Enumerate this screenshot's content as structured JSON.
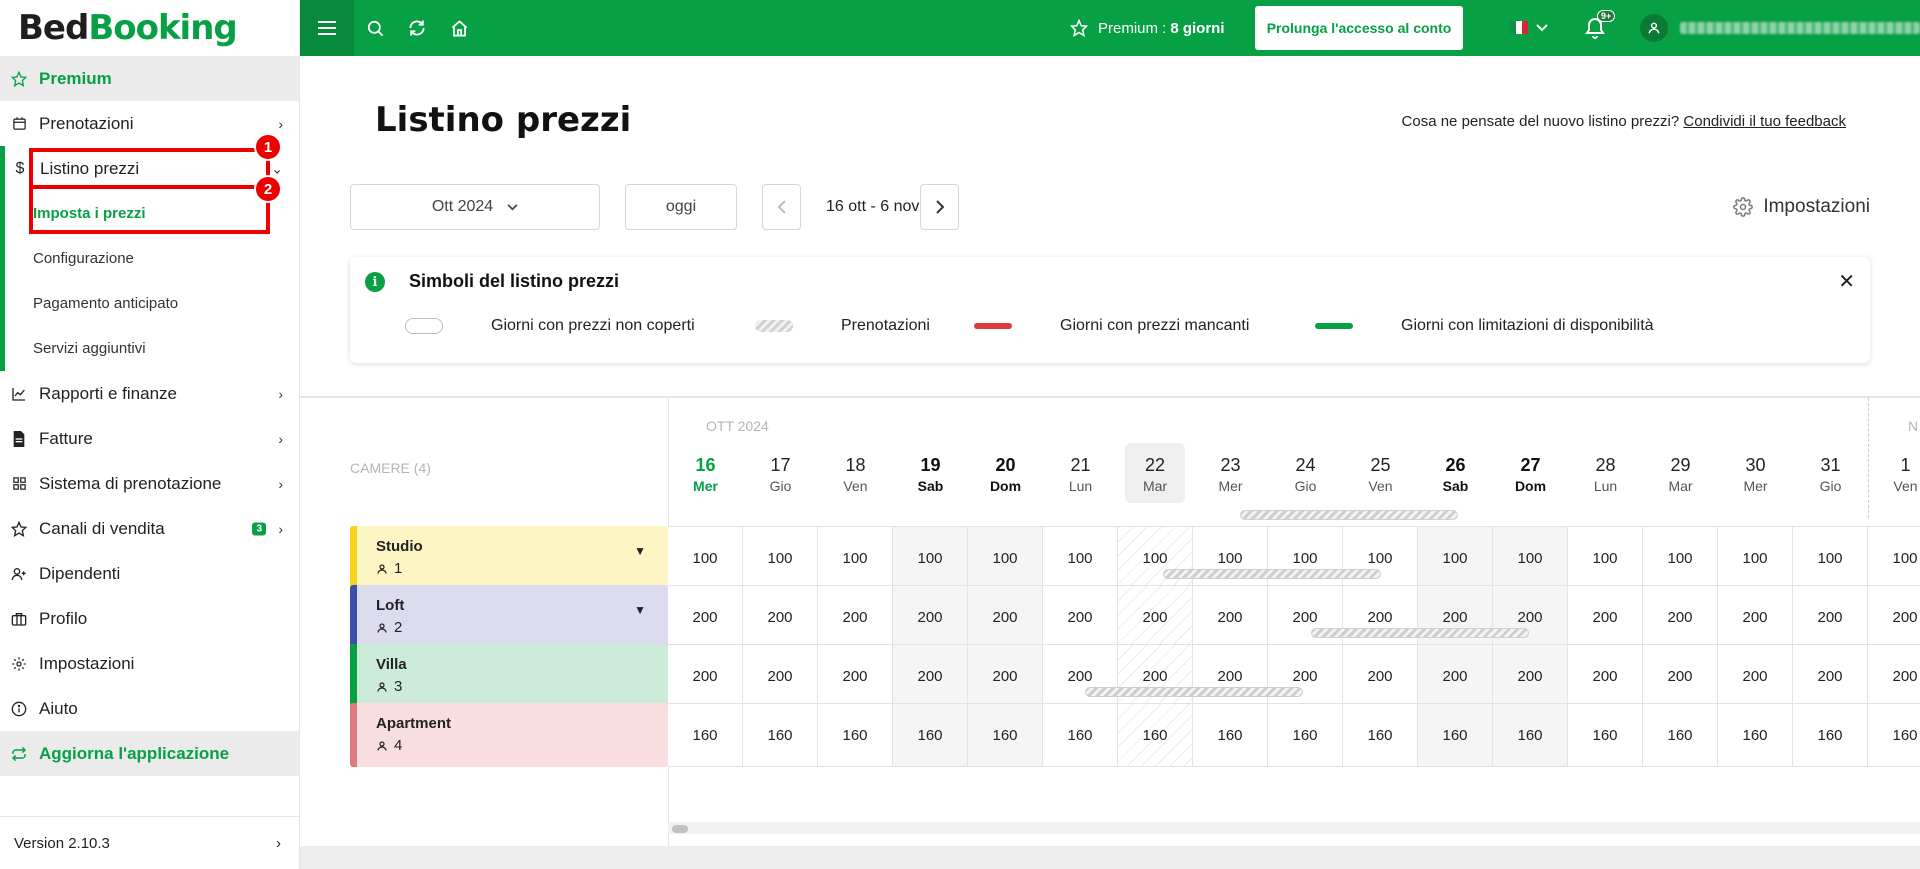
{
  "logo": {
    "part1": "Bed",
    "part2": "Booking"
  },
  "sidebar": {
    "premium": "Premium",
    "items": [
      {
        "label": "Prenotazioni",
        "icon": "calendar-icon"
      },
      {
        "label": "Listino prezzi",
        "icon": "dollar-icon"
      }
    ],
    "submenu": [
      "Imposta i prezzi",
      "Configurazione",
      "Pagamento anticipato",
      "Servizi aggiuntivi"
    ],
    "items2": [
      {
        "label": "Rapporti e finanze",
        "icon": "chart-icon"
      },
      {
        "label": "Fatture",
        "icon": "invoice-icon"
      },
      {
        "label": "Sistema di prenotazione",
        "icon": "grid-icon"
      },
      {
        "label": "Canali di vendita",
        "icon": "star-icon",
        "badge": "3"
      },
      {
        "label": "Dipendenti",
        "icon": "user-add-icon"
      },
      {
        "label": "Profilo",
        "icon": "briefcase-icon"
      },
      {
        "label": "Impostazioni",
        "icon": "gear-icon"
      },
      {
        "label": "Aiuto",
        "icon": "info-icon"
      }
    ],
    "update": "Aggiorna l'applicazione",
    "version": "Version 2.10.3"
  },
  "callouts": {
    "one": "1",
    "two": "2"
  },
  "topbar": {
    "premium_label": "Premium :",
    "premium_days": "8 giorni",
    "extend_button": "Prolunga l'accesso al conto",
    "notifications": "9+"
  },
  "page": {
    "title": "Listino prezzi",
    "feedback_text": "Cosa ne pensate del nuovo listino prezzi?",
    "feedback_link": "Condividi il tuo feedback",
    "month_select": "Ott 2024",
    "today_button": "oggi",
    "range": "16 ott - 6 nov",
    "settings": "Impostazioni"
  },
  "legend": {
    "title": "Simboli del listino prezzi",
    "items": [
      "Giorni con prezzi non coperti",
      "Prenotazioni",
      "Giorni con prezzi mancanti",
      "Giorni con limitazioni di disponibilità"
    ]
  },
  "grid": {
    "rooms_header": "CAMERE (4)",
    "month_label": "OTT 2024",
    "next_month_label": "N",
    "days": [
      {
        "n": "16",
        "w": "Mer"
      },
      {
        "n": "17",
        "w": "Gio"
      },
      {
        "n": "18",
        "w": "Ven"
      },
      {
        "n": "19",
        "w": "Sab"
      },
      {
        "n": "20",
        "w": "Dom"
      },
      {
        "n": "21",
        "w": "Lun"
      },
      {
        "n": "22",
        "w": "Mar"
      },
      {
        "n": "23",
        "w": "Mer"
      },
      {
        "n": "24",
        "w": "Gio"
      },
      {
        "n": "25",
        "w": "Ven"
      },
      {
        "n": "26",
        "w": "Sab"
      },
      {
        "n": "27",
        "w": "Dom"
      },
      {
        "n": "28",
        "w": "Lun"
      },
      {
        "n": "29",
        "w": "Mar"
      },
      {
        "n": "30",
        "w": "Mer"
      },
      {
        "n": "31",
        "w": "Gio"
      },
      {
        "n": "1",
        "w": "Ven"
      }
    ],
    "rooms": [
      {
        "name": "Studio",
        "capacity": "1",
        "price": "100",
        "color": "#f7d31c",
        "bg": "#fdf5c4",
        "dropdown": true
      },
      {
        "name": "Loft",
        "capacity": "2",
        "price": "200",
        "color": "#3f4fa8",
        "bg": "#dcdcee",
        "dropdown": true
      },
      {
        "name": "Villa",
        "capacity": "3",
        "price": "200",
        "color": "#08a045",
        "bg": "#cdebd9",
        "dropdown": false
      },
      {
        "name": "Apartment",
        "capacity": "4",
        "price": "160",
        "color": "#e07b7b",
        "bg": "#f8dede",
        "dropdown": false
      }
    ]
  },
  "colors": {
    "brand": "#08a045",
    "callout": "#ee0000"
  }
}
